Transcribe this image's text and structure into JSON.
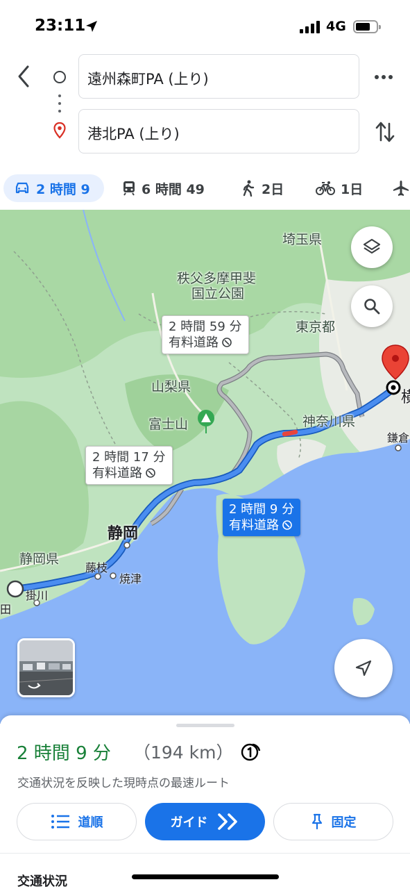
{
  "status_bar": {
    "time": "23:11",
    "network": "4G"
  },
  "route": {
    "origin": "遠州森町PA (上り)",
    "destination": "港北PA (上り)"
  },
  "modes": [
    {
      "label": "2 時間 9",
      "icon": "car-icon",
      "selected": true
    },
    {
      "label": "6 時間 49",
      "icon": "train-icon",
      "selected": false
    },
    {
      "label": "2日",
      "icon": "walk-icon",
      "selected": false
    },
    {
      "label": "1日",
      "icon": "bike-icon",
      "selected": false
    },
    {
      "label": "",
      "icon": "flight-icon",
      "selected": false
    }
  ],
  "map": {
    "regions": [
      "埼玉県",
      "秩父多摩甲斐",
      "国立公園",
      "東京都",
      "山梨県",
      "富士山",
      "神奈川県",
      "静岡県"
    ],
    "cities": [
      "静岡",
      "藤枝",
      "焼津",
      "掛川",
      "横",
      "鎌倉",
      "田"
    ],
    "callouts": [
      {
        "line1": "2 時間 59 分",
        "line2": "有料道路",
        "type": "alternate"
      },
      {
        "line1": "2 時間 17 分",
        "line2": "有料道路",
        "type": "alternate"
      },
      {
        "line1": "2 時間 9 分",
        "line2": "有料道路",
        "type": "selected"
      }
    ],
    "colors": {
      "route": "#1a73e8",
      "alt_route": "#9aa0a6",
      "land": "#bfe3bf",
      "sea": "#8ab4f8",
      "traffic": "#e8453c"
    }
  },
  "summary": {
    "duration": "2 時間 9 分",
    "distance": "（194 km）",
    "description": "交通状況を反映した現時点の最速ルート"
  },
  "buttons": {
    "steps": "道順",
    "guide": "ガイド",
    "pin": "固定"
  },
  "traffic_heading": "交通状況"
}
